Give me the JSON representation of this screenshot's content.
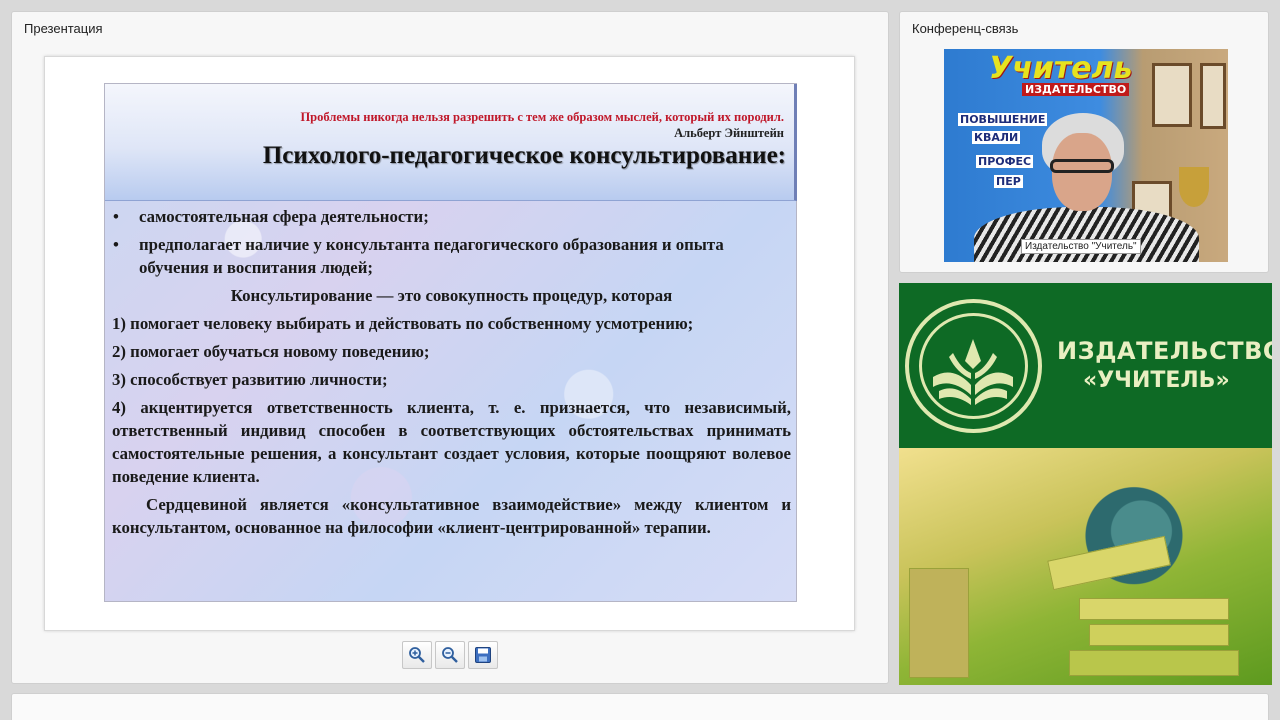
{
  "presentation_panel": {
    "title": "Презентация",
    "slide": {
      "quote": "Проблемы никогда нельзя разрешить с тем же образом мыслей, который их породил.",
      "quote_author": "Альберт Эйнштейн",
      "title": "Психолого-педагогическое консультирование:",
      "bullets": [
        "самостоятельная  сфера деятельности;",
        "предполагает наличие у консультанта педагогического образования и опыта обучения и воспитания людей;"
      ],
      "definition": "Консультирование — это совокупность процедур, которая",
      "items": [
        "1)  помогает  человеку  выбирать  и  действовать  по  собственному усмотрению;",
        "2)   помогает обучаться новому поведению;",
        "3)   способствует развитию личности;",
        "4)  акцентируется  ответственность  клиента,  т.  е.  признается,  что независимый,  ответственный  индивид  способен  в  соответствующих обстоятельствах принимать самостоятельные решения, а консультант создает условия, которые поощряют волевое поведение клиента."
      ],
      "closing": "Сердцевиной является «консультативное взаимодействие» между клиентом  и  консультантом,  основанное  на  философии  «клиент-центрированной» терапии."
    },
    "toolbar": {
      "zoom_in_icon": "zoom-in-icon",
      "zoom_out_icon": "zoom-out-icon",
      "save_icon": "floppy-disk-icon"
    }
  },
  "conference_panel": {
    "title": "Конференц-связь",
    "video": {
      "banner": "Учитель",
      "banner_sub": "ИЗДАТЕЛЬСТВО",
      "lines": [
        "ПОВЫШЕНИЕ",
        "КВАЛИ",
        "ПРОФЕС",
        "ПЕР"
      ],
      "participant_label": "Издательство \"Учитель\""
    }
  },
  "publisher_banner": {
    "name_line1": "ИЗДАТЕЛЬСТВО",
    "name_line2": "«УЧИТЕЛЬ»"
  },
  "colors": {
    "publisher_green": "#0e6a25",
    "quote_red": "#c0182a"
  }
}
